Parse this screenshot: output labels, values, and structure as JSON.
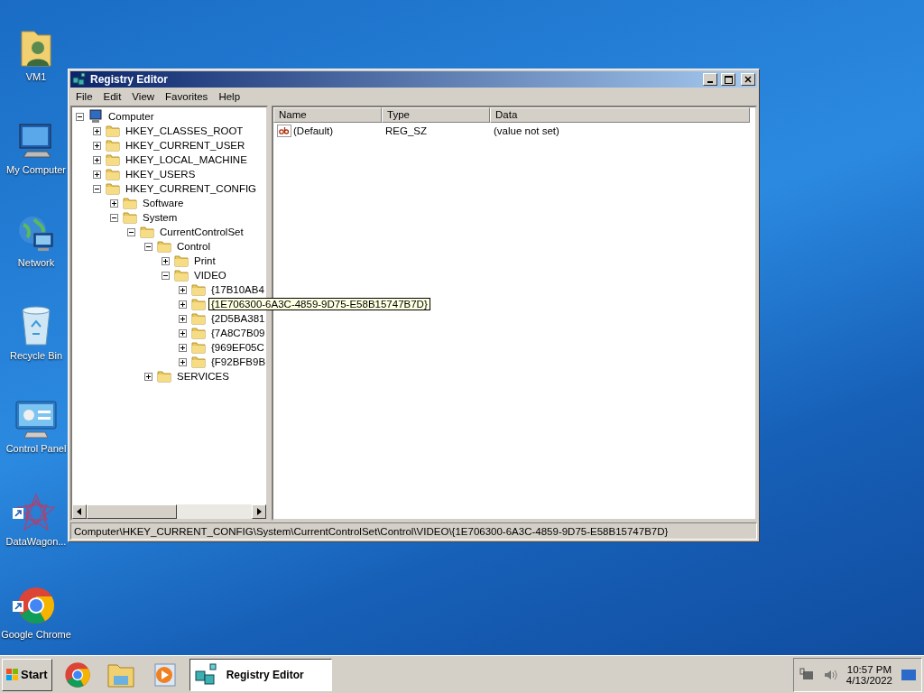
{
  "desktop_icons": [
    {
      "label": "VM1",
      "kind": "user-folder",
      "shortcut": false
    },
    {
      "label": "My Computer",
      "kind": "computer",
      "shortcut": false
    },
    {
      "label": "Network",
      "kind": "network",
      "shortcut": false
    },
    {
      "label": "Recycle Bin",
      "kind": "recycle-bin",
      "shortcut": false
    },
    {
      "label": "Control Panel",
      "kind": "control-panel",
      "shortcut": false
    },
    {
      "label": "DataWagon...",
      "kind": "app",
      "shortcut": true
    },
    {
      "label": "Google Chrome",
      "kind": "chrome",
      "shortcut": true
    }
  ],
  "window": {
    "title": "Registry Editor",
    "menu": [
      "File",
      "Edit",
      "View",
      "Favorites",
      "Help"
    ],
    "tree": [
      {
        "label": "Computer",
        "kind": "computer",
        "expanded": true,
        "selected": false,
        "children": [
          {
            "label": "HKEY_CLASSES_ROOT",
            "kind": "folder",
            "expanded": false,
            "selected": false
          },
          {
            "label": "HKEY_CURRENT_USER",
            "kind": "folder",
            "expanded": false,
            "selected": false
          },
          {
            "label": "HKEY_LOCAL_MACHINE",
            "kind": "folder",
            "expanded": false,
            "selected": false
          },
          {
            "label": "HKEY_USERS",
            "kind": "folder",
            "expanded": false,
            "selected": false
          },
          {
            "label": "HKEY_CURRENT_CONFIG",
            "kind": "folder",
            "expanded": true,
            "selected": false,
            "children": [
              {
                "label": "Software",
                "kind": "folder",
                "expanded": false,
                "selected": false
              },
              {
                "label": "System",
                "kind": "folder",
                "expanded": true,
                "selected": false,
                "children": [
                  {
                    "label": "CurrentControlSet",
                    "kind": "folder",
                    "expanded": true,
                    "selected": false,
                    "children": [
                      {
                        "label": "Control",
                        "kind": "folder",
                        "expanded": true,
                        "selected": false,
                        "children": [
                          {
                            "label": "Print",
                            "kind": "folder",
                            "expanded": false,
                            "selected": false
                          },
                          {
                            "label": "VIDEO",
                            "kind": "folder",
                            "expanded": true,
                            "selected": false,
                            "children": [
                              {
                                "label": "{17B10AB4",
                                "kind": "folder",
                                "expanded": false,
                                "selected": false
                              },
                              {
                                "label": "{1E706300-6A3C-4859-9D75-E58B15747B7D}",
                                "kind": "folder",
                                "expanded": false,
                                "selected": true
                              },
                              {
                                "label": "{2D5BA381",
                                "kind": "folder",
                                "expanded": false,
                                "selected": false
                              },
                              {
                                "label": "{7A8C7B09",
                                "kind": "folder",
                                "expanded": false,
                                "selected": false
                              },
                              {
                                "label": "{969EF05C",
                                "kind": "folder",
                                "expanded": false,
                                "selected": false
                              },
                              {
                                "label": "{F92BFB9B",
                                "kind": "folder",
                                "expanded": false,
                                "selected": false
                              }
                            ]
                          }
                        ]
                      },
                      {
                        "label": "SERVICES",
                        "kind": "folder",
                        "expanded": false,
                        "selected": false
                      }
                    ]
                  }
                ]
              }
            ]
          }
        ]
      }
    ],
    "columns": [
      "Name",
      "Type",
      "Data"
    ],
    "values": [
      {
        "name": "(Default)",
        "type": "REG_SZ",
        "data": "(value not set)"
      }
    ],
    "status_bar": "Computer\\HKEY_CURRENT_CONFIG\\System\\CurrentControlSet\\Control\\VIDEO\\{1E706300-6A3C-4859-9D75-E58B15747B7D}"
  },
  "taskbar": {
    "start": "Start",
    "pinned": [
      {
        "kind": "chrome"
      },
      {
        "kind": "explorer"
      },
      {
        "kind": "media-player"
      }
    ],
    "tasks": [
      {
        "label": "Registry Editor",
        "selected": true
      }
    ],
    "clock": {
      "time": "10:57 PM",
      "date": "4/13/2022"
    }
  }
}
